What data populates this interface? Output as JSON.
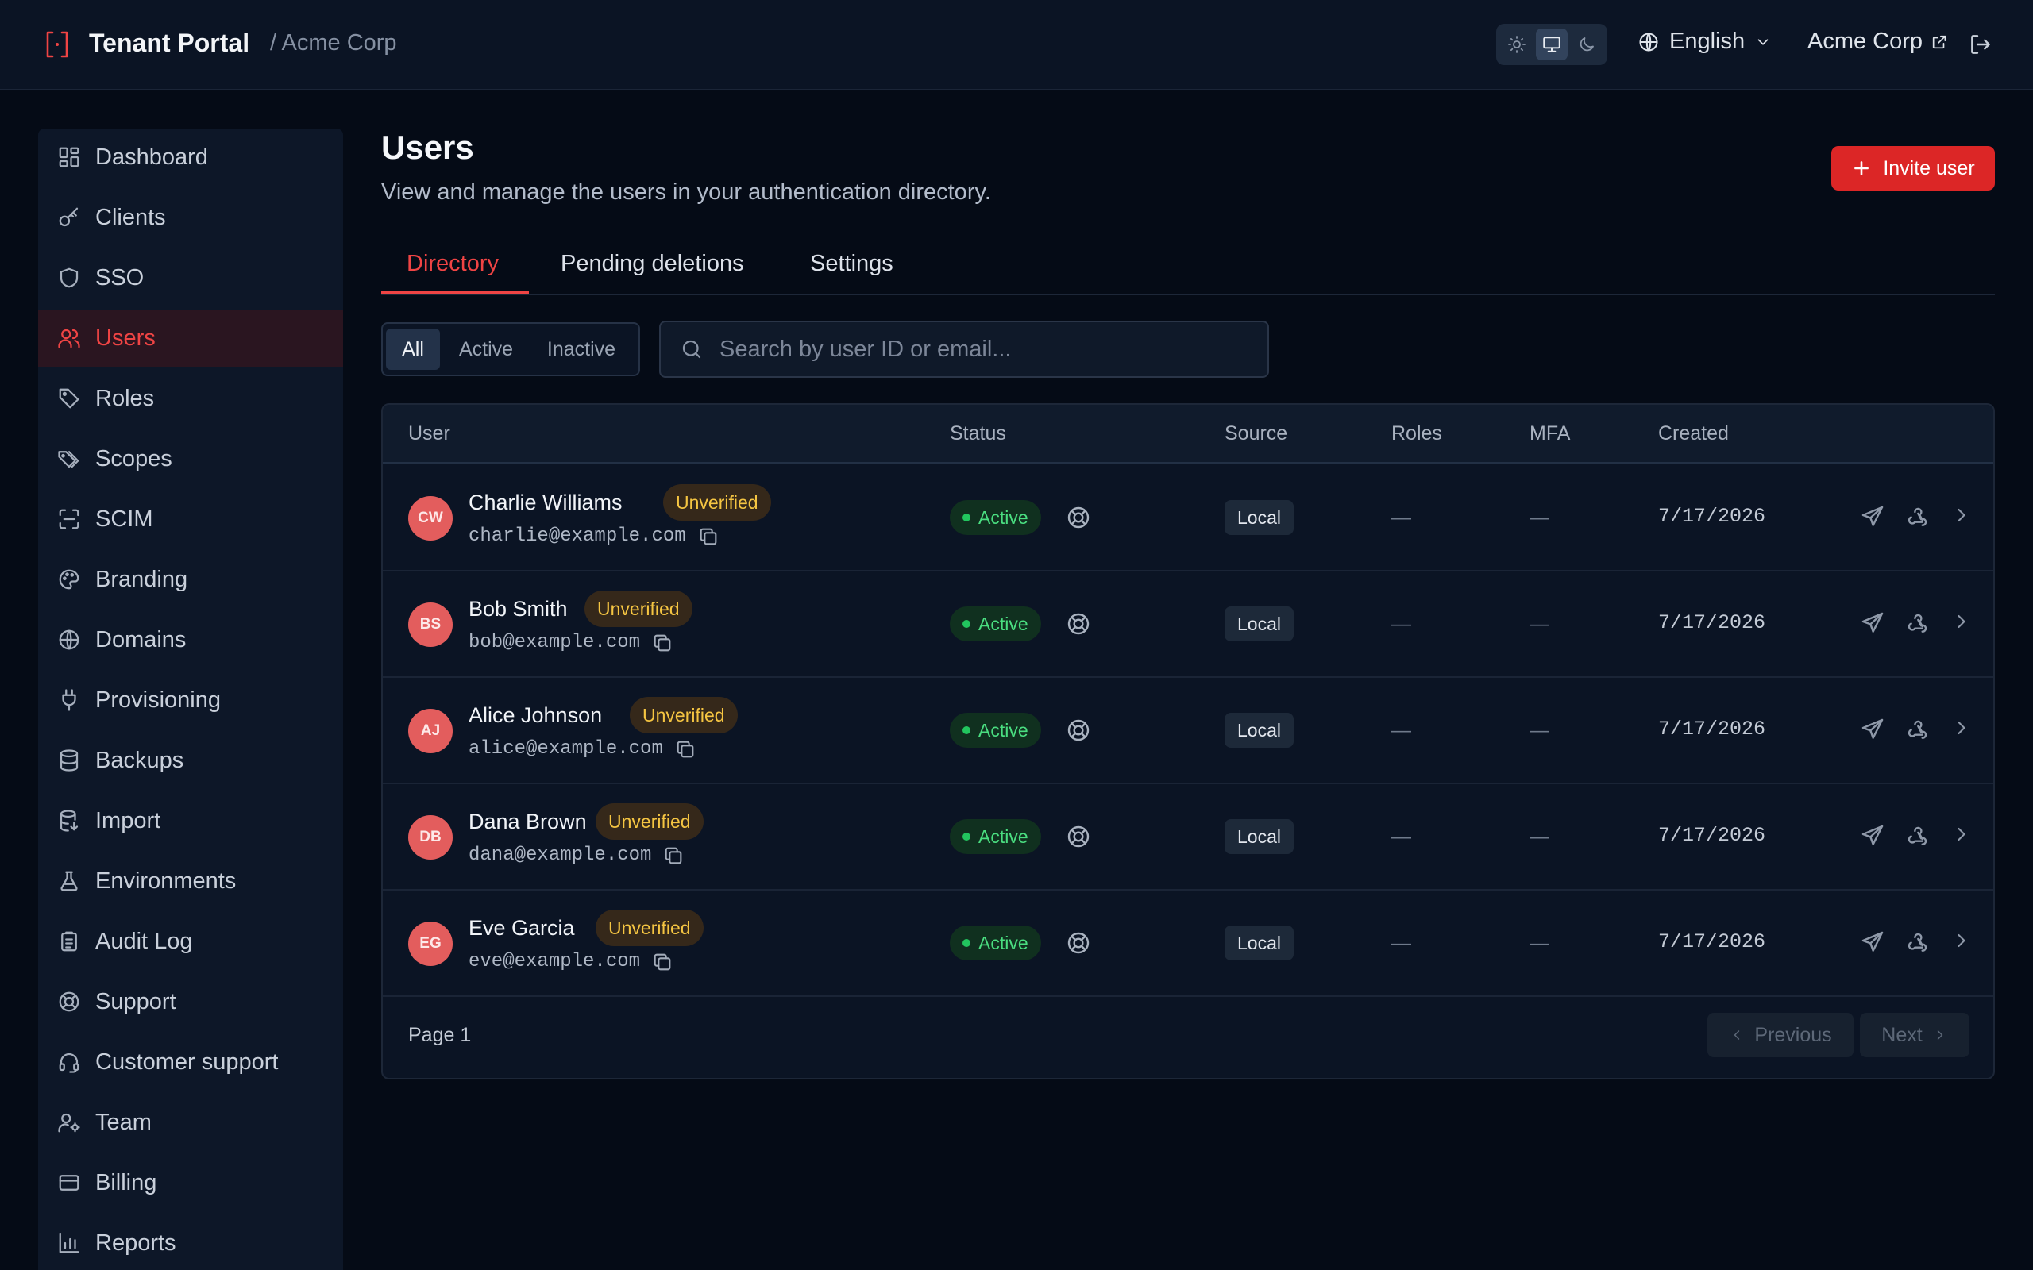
{
  "header": {
    "app_title": "Tenant Portal",
    "breadcrumb": "/ Acme Corp",
    "language": "English",
    "org_link": "Acme Corp"
  },
  "sidebar": {
    "items": [
      {
        "label": "Dashboard",
        "icon": "dashboard-icon"
      },
      {
        "label": "Clients",
        "icon": "key-icon"
      },
      {
        "label": "SSO",
        "icon": "shield-icon"
      },
      {
        "label": "Users",
        "icon": "users-icon",
        "active": true
      },
      {
        "label": "Roles",
        "icon": "tag-icon"
      },
      {
        "label": "Scopes",
        "icon": "tags-icon"
      },
      {
        "label": "SCIM",
        "icon": "scan-icon"
      },
      {
        "label": "Branding",
        "icon": "palette-icon"
      },
      {
        "label": "Domains",
        "icon": "globe-icon"
      },
      {
        "label": "Provisioning",
        "icon": "plug-icon"
      },
      {
        "label": "Backups",
        "icon": "database-icon"
      },
      {
        "label": "Import",
        "icon": "database-import-icon"
      },
      {
        "label": "Environments",
        "icon": "flask-icon"
      },
      {
        "label": "Audit Log",
        "icon": "clipboard-icon"
      },
      {
        "label": "Support",
        "icon": "lifebuoy-icon"
      },
      {
        "label": "Customer support",
        "icon": "headset-icon"
      },
      {
        "label": "Team",
        "icon": "user-cog-icon"
      },
      {
        "label": "Billing",
        "icon": "credit-card-icon"
      },
      {
        "label": "Reports",
        "icon": "bar-chart-icon"
      }
    ]
  },
  "page": {
    "title": "Users",
    "subtitle": "View and manage the users in your authentication directory.",
    "invite_label": "Invite user"
  },
  "tabs": [
    "Directory",
    "Pending deletions",
    "Settings"
  ],
  "filter": {
    "options": [
      "All",
      "Active",
      "Inactive"
    ],
    "selected": "All"
  },
  "search": {
    "placeholder": "Search by user ID or email..."
  },
  "table": {
    "columns": [
      "User",
      "Status",
      "Source",
      "Roles",
      "MFA",
      "Created"
    ],
    "rows": [
      {
        "initials": "CW",
        "name": "Charlie Williams",
        "badge": "Unverified",
        "email": "charlie@example.com",
        "status": "Active",
        "source": "Local",
        "roles": "—",
        "mfa": "—",
        "created": "7/17/2026"
      },
      {
        "initials": "BS",
        "name": "Bob Smith",
        "badge": "Unverified",
        "email": "bob@example.com",
        "status": "Active",
        "source": "Local",
        "roles": "—",
        "mfa": "—",
        "created": "7/17/2026"
      },
      {
        "initials": "AJ",
        "name": "Alice Johnson",
        "badge": "Unverified",
        "email": "alice@example.com",
        "status": "Active",
        "source": "Local",
        "roles": "—",
        "mfa": "—",
        "created": "7/17/2026"
      },
      {
        "initials": "DB",
        "name": "Dana Brown",
        "badge": "Unverified",
        "email": "dana@example.com",
        "status": "Active",
        "source": "Local",
        "roles": "—",
        "mfa": "—",
        "created": "7/17/2026"
      },
      {
        "initials": "EG",
        "name": "Eve Garcia",
        "badge": "Unverified",
        "email": "eve@example.com",
        "status": "Active",
        "source": "Local",
        "roles": "—",
        "mfa": "—",
        "created": "7/17/2026"
      }
    ],
    "footer": {
      "page_label": "Page 1",
      "previous": "Previous",
      "next": "Next"
    }
  },
  "colors": {
    "accent": "#ef4444",
    "background": "#050b16",
    "sidebar": "#0d1728",
    "active_green": "#22c55e",
    "unverified_yellow": "#f5c542"
  }
}
